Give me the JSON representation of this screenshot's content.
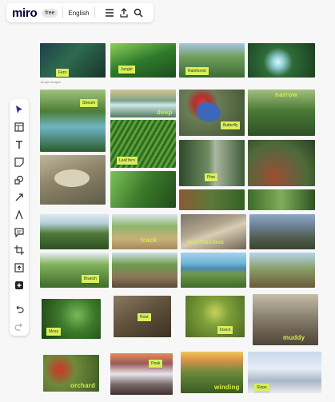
{
  "topbar": {
    "logo": "miro",
    "plan_badge": "free",
    "language": "English",
    "icons": [
      "menu-icon",
      "share-icon",
      "search-icon"
    ]
  },
  "board": {
    "frame_label": "Jungle Images"
  },
  "images": [
    {
      "id": "fern-1",
      "tag": "Fern",
      "word": ""
    },
    {
      "id": "jungle",
      "tag": "Jungle",
      "word": ""
    },
    {
      "id": "rainforest",
      "tag": "Rainforest",
      "word": ""
    },
    {
      "id": "waterfall-1",
      "tag": "",
      "word": ""
    },
    {
      "id": "stream",
      "tag": "Stream",
      "word": ""
    },
    {
      "id": "deep",
      "tag": "",
      "word": "deep"
    },
    {
      "id": "butterfly",
      "tag": "Butterfly",
      "word": ""
    },
    {
      "id": "narrow",
      "tag": "",
      "word": "narrow"
    },
    {
      "id": "leaf-fern",
      "tag": "Leaf fern",
      "word": ""
    },
    {
      "id": "frog",
      "tag": "",
      "word": ""
    },
    {
      "id": "forest",
      "tag": "Pine",
      "word": ""
    },
    {
      "id": "rocks",
      "tag": "",
      "word": ""
    },
    {
      "id": "leopard",
      "tag": "",
      "word": ""
    },
    {
      "id": "monkey",
      "tag": "",
      "word": ""
    },
    {
      "id": "pinecone",
      "tag": "",
      "word": ""
    },
    {
      "id": "fern-2",
      "tag": "",
      "word": ""
    },
    {
      "id": "plants",
      "tag": "",
      "word": ""
    },
    {
      "id": "hills",
      "tag": "",
      "word": ""
    },
    {
      "id": "track",
      "tag": "",
      "word": "track"
    },
    {
      "id": "mountainous",
      "tag": "",
      "word": "mountainous"
    },
    {
      "id": "rocky-peaks",
      "tag": "",
      "word": ""
    },
    {
      "id": "branch",
      "tag": "Branch",
      "word": ""
    },
    {
      "id": "bridge",
      "tag": "",
      "word": ""
    },
    {
      "id": "lake",
      "tag": "",
      "word": ""
    },
    {
      "id": "valley",
      "tag": "",
      "word": ""
    },
    {
      "id": "moss-1",
      "tag": "Moss",
      "word": ""
    },
    {
      "id": "old-tree",
      "tag": "Root",
      "word": ""
    },
    {
      "id": "moss-2",
      "tag": "Insect",
      "word": ""
    },
    {
      "id": "muddy",
      "tag": "",
      "word": "muddy"
    },
    {
      "id": "orchard",
      "tag": "",
      "word": "orchard"
    },
    {
      "id": "peak",
      "tag": "Peak",
      "word": ""
    },
    {
      "id": "winding",
      "tag": "",
      "word": "winding"
    },
    {
      "id": "snow",
      "tag": "Slope",
      "word": ""
    }
  ],
  "toolbar": {
    "tools": [
      "select",
      "frame",
      "text",
      "sticky-note",
      "shapes",
      "connection-line",
      "pen",
      "comment",
      "crop",
      "upload",
      "add",
      "undo",
      "redo"
    ]
  }
}
